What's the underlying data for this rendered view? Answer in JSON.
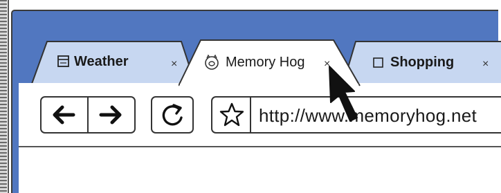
{
  "tabs": [
    {
      "label": "Weather",
      "icon": "page-icon",
      "close": "×",
      "active": false
    },
    {
      "label": "Memory Hog",
      "icon": "pig-icon",
      "close": "×",
      "active": true
    },
    {
      "label": "Shopping",
      "icon": "page-icon",
      "close": "×",
      "active": false
    }
  ],
  "toolbar": {
    "back_icon": "left-arrow-icon",
    "forward_icon": "right-arrow-icon",
    "reload_icon": "reload-icon",
    "bookmark_icon": "star-icon"
  },
  "address_bar": {
    "url": "http://www.memoryhog.net"
  },
  "colors": {
    "frame": "#5177c0",
    "inactive_tab": "#c7d7f1",
    "active_tab": "#ffffff",
    "outline": "#333333"
  },
  "pointer": "arrow-cursor-icon"
}
